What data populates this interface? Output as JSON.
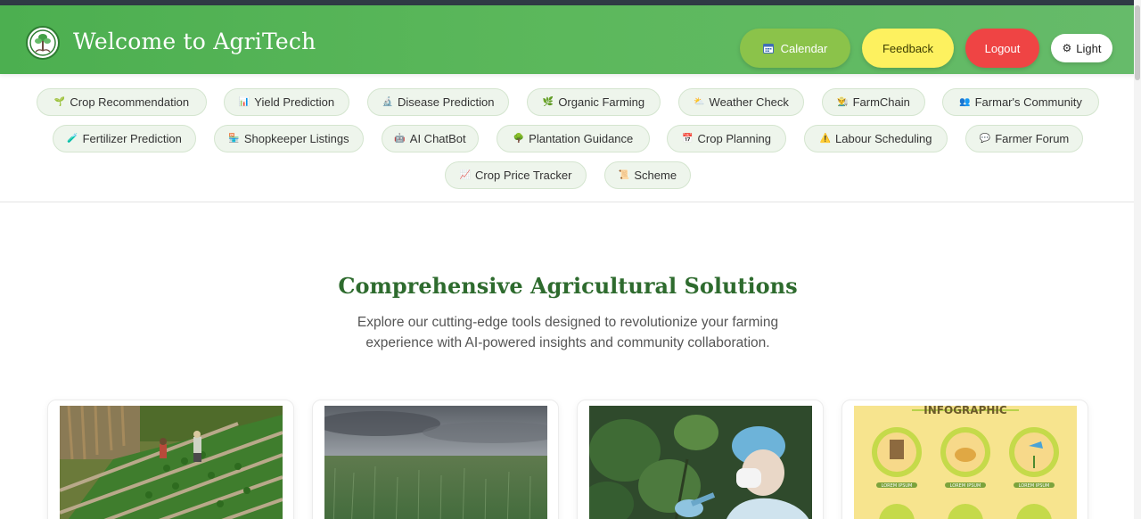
{
  "header": {
    "title": "Welcome to AgriTech",
    "calendar_label": "Calendar",
    "feedback_label": "Feedback",
    "logout_label": "Logout",
    "theme_label": "Light"
  },
  "nav": {
    "row1": [
      {
        "icon": "🌱",
        "label": "Crop Recommendation"
      },
      {
        "icon": "📊",
        "label": "Yield Prediction"
      },
      {
        "icon": "🔬",
        "label": "Disease Prediction"
      },
      {
        "icon": "🌿",
        "label": "Organic Farming"
      },
      {
        "icon": "⛅",
        "label": "Weather Check"
      },
      {
        "icon": "👨‍🌾",
        "label": "FarmChain"
      },
      {
        "icon": "👥",
        "label": "Farmar's Community"
      }
    ],
    "row2": [
      {
        "icon": "🧪",
        "label": "Fertilizer Prediction"
      },
      {
        "icon": "🏪",
        "label": "Shopkeeper Listings"
      },
      {
        "icon": "🤖",
        "label": "AI ChatBot"
      },
      {
        "icon": "🌳",
        "label": "Plantation Guidance"
      },
      {
        "icon": "📅",
        "label": "Crop Planning"
      },
      {
        "icon": "⚠️",
        "label": "Labour Scheduling"
      },
      {
        "icon": "💬",
        "label": "Farmer Forum"
      }
    ],
    "row3": [
      {
        "icon": "📈",
        "label": "Crop Price Tracker"
      },
      {
        "icon": "📜",
        "label": "Scheme"
      }
    ]
  },
  "section": {
    "title": "Comprehensive Agricultural Solutions",
    "subtitle": "Explore our cutting-edge tools designed to revolutionize your farming experience with AI-powered insights and community collaboration."
  },
  "cards": {
    "infographic_heading": "INFOGRAPHIC",
    "infographic_caption": "LOREM IPSUM"
  },
  "colors": {
    "header_green": "#4caf50",
    "calendar_green": "#8bc34a",
    "feedback_yellow": "#fdf15f",
    "logout_red": "#ef4444",
    "title_green": "#2e6b2e"
  }
}
